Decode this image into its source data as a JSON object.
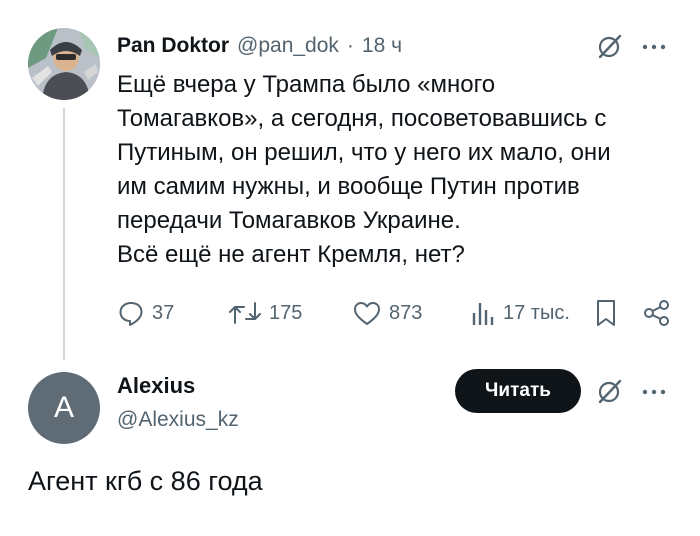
{
  "tweet": {
    "author_name": "Pan Doktor",
    "author_handle": "@pan_dok",
    "separator": "·",
    "time": "18 ч",
    "text_lines": [
      "Ещё вчера у Трампа было «много",
      "Томагавков», а сегодня, посоветовавшись с",
      "Путиным, он решил, что у него их мало, они",
      "им самим нужны, и вообще Путин против",
      "передачи Томагавков Украине.",
      "Всё ещё не агент Кремля, нет?"
    ],
    "stats": {
      "replies": "37",
      "reposts": "175",
      "likes": "873",
      "views": "17 тыс."
    },
    "icons": [
      "grok-icon",
      "more-icon",
      "reply-icon",
      "repost-icon",
      "like-icon",
      "views-icon",
      "bookmark-icon",
      "share-icon"
    ]
  },
  "reply": {
    "avatar_letter": "A",
    "author_name": "Alexius",
    "author_handle": "@Alexius_kz",
    "read_button": "Читать",
    "text": "Агент кгб с 86 года"
  },
  "colors": {
    "text": "#0f1419",
    "secondary": "#536471",
    "thread_line": "#cfd9de",
    "button_bg": "#0f1419",
    "avatar2_bg": "#5f6b75"
  }
}
